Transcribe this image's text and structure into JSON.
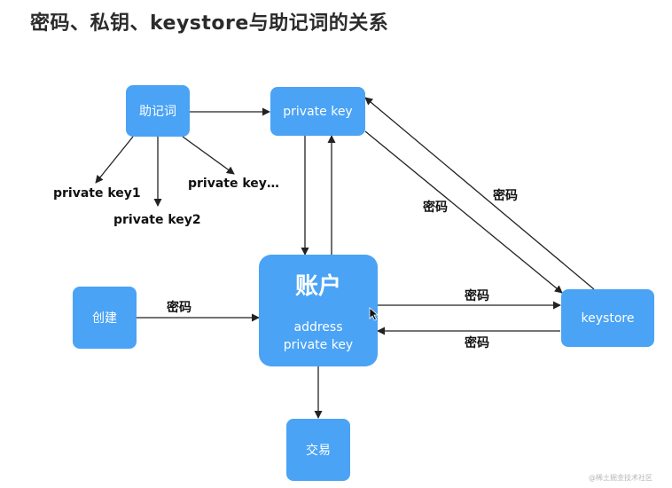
{
  "title": "密码、私钥、keystore与助记词的关系",
  "nodes": {
    "mnemonic": "助记词",
    "private_key": "private key",
    "account_title": "账户",
    "account_address": "address",
    "account_private_key": "private key",
    "create": "创建",
    "keystore": "keystore",
    "transaction": "交易"
  },
  "labels": {
    "pk1": "private key1",
    "pk2": "private key2",
    "pkn": "private key…",
    "pwd_create": "密码",
    "pwd_pk_to_ks": "密码",
    "pwd_ks_to_pk": "密码",
    "pwd_acc_to_ks": "密码",
    "pwd_ks_to_acc": "密码"
  },
  "watermark": "@稀土掘金技术社区",
  "colors": {
    "node": "#4aa3f5",
    "arrow": "#222222"
  }
}
